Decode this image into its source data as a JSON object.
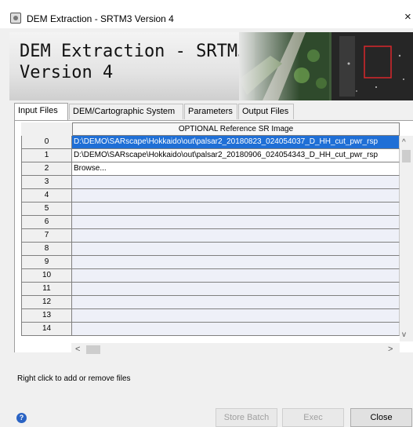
{
  "window": {
    "title": "DEM Extraction - SRTM3 Version 4",
    "close_glyph": "×"
  },
  "banner": {
    "title_line1": "DEM Extraction - SRTM3",
    "title_line2": "Version 4"
  },
  "tabs": [
    {
      "label": "Input Files",
      "active": true
    },
    {
      "label": "DEM/Cartographic System",
      "active": false
    },
    {
      "label": "Parameters",
      "active": false
    },
    {
      "label": "Output Files",
      "active": false
    }
  ],
  "table": {
    "column_header": "OPTIONAL Reference SR Image",
    "rows": [
      {
        "index": "0",
        "value": "D:\\DEMO\\SARscape\\Hokkaido\\out\\palsar2_20180823_024054037_D_HH_cut_pwr_rsp"
      },
      {
        "index": "1",
        "value": "D:\\DEMO\\SARscape\\Hokkaido\\out\\palsar2_20180906_024054343_D_HH_cut_pwr_rsp"
      },
      {
        "index": "2",
        "value": "Browse..."
      },
      {
        "index": "3",
        "value": ""
      },
      {
        "index": "4",
        "value": ""
      },
      {
        "index": "5",
        "value": ""
      },
      {
        "index": "6",
        "value": ""
      },
      {
        "index": "7",
        "value": ""
      },
      {
        "index": "8",
        "value": ""
      },
      {
        "index": "9",
        "value": ""
      },
      {
        "index": "10",
        "value": ""
      },
      {
        "index": "11",
        "value": ""
      },
      {
        "index": "12",
        "value": ""
      },
      {
        "index": "13",
        "value": ""
      },
      {
        "index": "14",
        "value": ""
      }
    ]
  },
  "hint": "Right click to add or remove files",
  "buttons": {
    "help": "?",
    "store_batch": "Store Batch",
    "exec": "Exec",
    "close": "Close"
  },
  "colors": {
    "selection": "#1f6fd6",
    "row_fill": "#eef0f8",
    "help_blue": "#2a63c4"
  },
  "icons": {
    "scroll_up": "^",
    "scroll_down": "v",
    "scroll_left": "<",
    "scroll_right": ">"
  }
}
